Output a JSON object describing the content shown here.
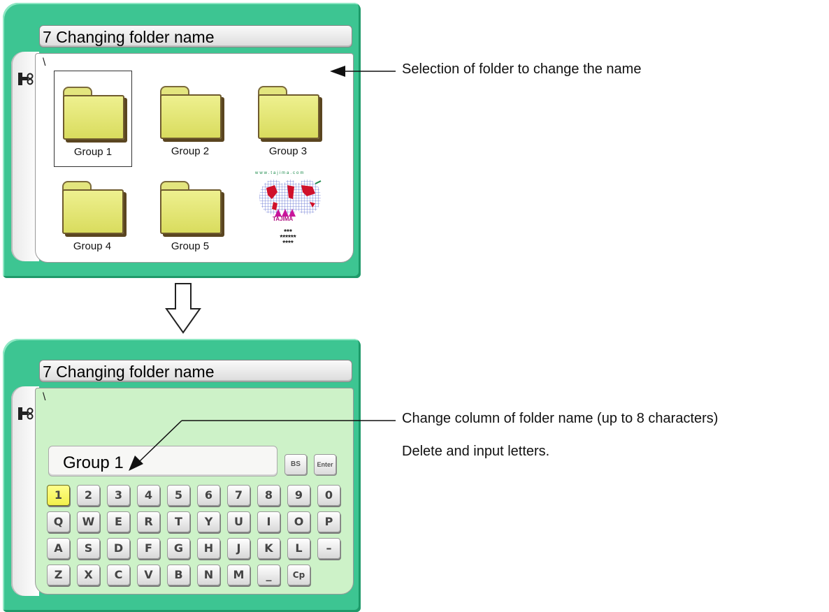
{
  "top_screen": {
    "title": "7 Changing folder name",
    "path": "\\",
    "folders": [
      "Group 1",
      "Group 2",
      "Group 3",
      "Group 4",
      "Group 5"
    ],
    "selected_folder": "Group 1",
    "logo": {
      "site": "www.tajima.com",
      "brand": "TAJIMA",
      "stars": [
        "***",
        "******",
        "****"
      ]
    }
  },
  "bottom_screen": {
    "title": "7 Changing folder name",
    "path": "\\",
    "name_field_value": "Group 1",
    "bs_label": "BS",
    "enter_label": "Enter",
    "keyboard_rows": [
      [
        "1",
        "2",
        "3",
        "4",
        "5",
        "6",
        "7",
        "8",
        "9",
        "0"
      ],
      [
        "Q",
        "W",
        "E",
        "R",
        "T",
        "Y",
        "U",
        "I",
        "O",
        "P"
      ],
      [
        "A",
        "S",
        "D",
        "F",
        "G",
        "H",
        "J",
        "K",
        "L",
        "–"
      ],
      [
        "Z",
        "X",
        "C",
        "V",
        "B",
        "N",
        "M",
        "_",
        "Cp"
      ]
    ],
    "active_key": "1"
  },
  "annotations": {
    "select_folder": "Selection of folder to change the name",
    "change_column": "Change column of folder name (up to 8 characters)",
    "delete_input": "Delete and input letters."
  },
  "icons": [
    "tool-icon",
    "down-arrow-icon",
    "folder-icon",
    "logo-icon"
  ],
  "colors": {
    "frame": "#3dc592",
    "panel_bottom": "#cdf2c8",
    "folder": "#e3e57e",
    "active_key": "#f2f04c"
  }
}
